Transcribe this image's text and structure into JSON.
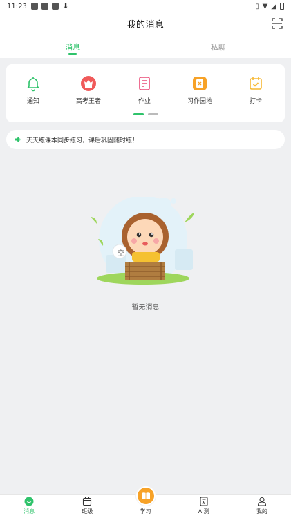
{
  "status_bar": {
    "time": "11:23"
  },
  "header": {
    "title": "我的消息",
    "scan_icon": "scan-icon"
  },
  "tabs": [
    {
      "label": "消息",
      "active": true
    },
    {
      "label": "私聊",
      "active": false
    }
  ],
  "quick_actions": [
    {
      "label": "通知",
      "icon": "bell-icon",
      "color": "#2fc36b"
    },
    {
      "label": "高考王者",
      "icon": "gaokao-badge-icon",
      "color": "#f05a5a"
    },
    {
      "label": "作业",
      "icon": "homework-icon",
      "color": "#e94b77"
    },
    {
      "label": "习作园地",
      "icon": "writing-icon",
      "color": "#f7a227"
    },
    {
      "label": "打卡",
      "icon": "checkin-icon",
      "color": "#f7b833"
    }
  ],
  "carousel": {
    "pages": 2,
    "current": 1
  },
  "notice": {
    "text": "天天练课本同步练习，课后巩固随时练！",
    "icon": "speaker-icon"
  },
  "empty_state": {
    "badge": "空",
    "text": "暂无消息"
  },
  "bottom_nav": [
    {
      "label": "消息",
      "icon": "message-icon",
      "active": true
    },
    {
      "label": "班级",
      "icon": "calendar-icon",
      "active": false
    },
    {
      "label": "学习",
      "icon": "book-icon",
      "active": false
    },
    {
      "label": "AI测",
      "icon": "ai-test-icon",
      "active": false
    },
    {
      "label": "我的",
      "icon": "profile-icon",
      "active": false
    }
  ],
  "colors": {
    "accent": "#2fc36b",
    "background": "#eff0f2",
    "study": "#f7a227"
  }
}
